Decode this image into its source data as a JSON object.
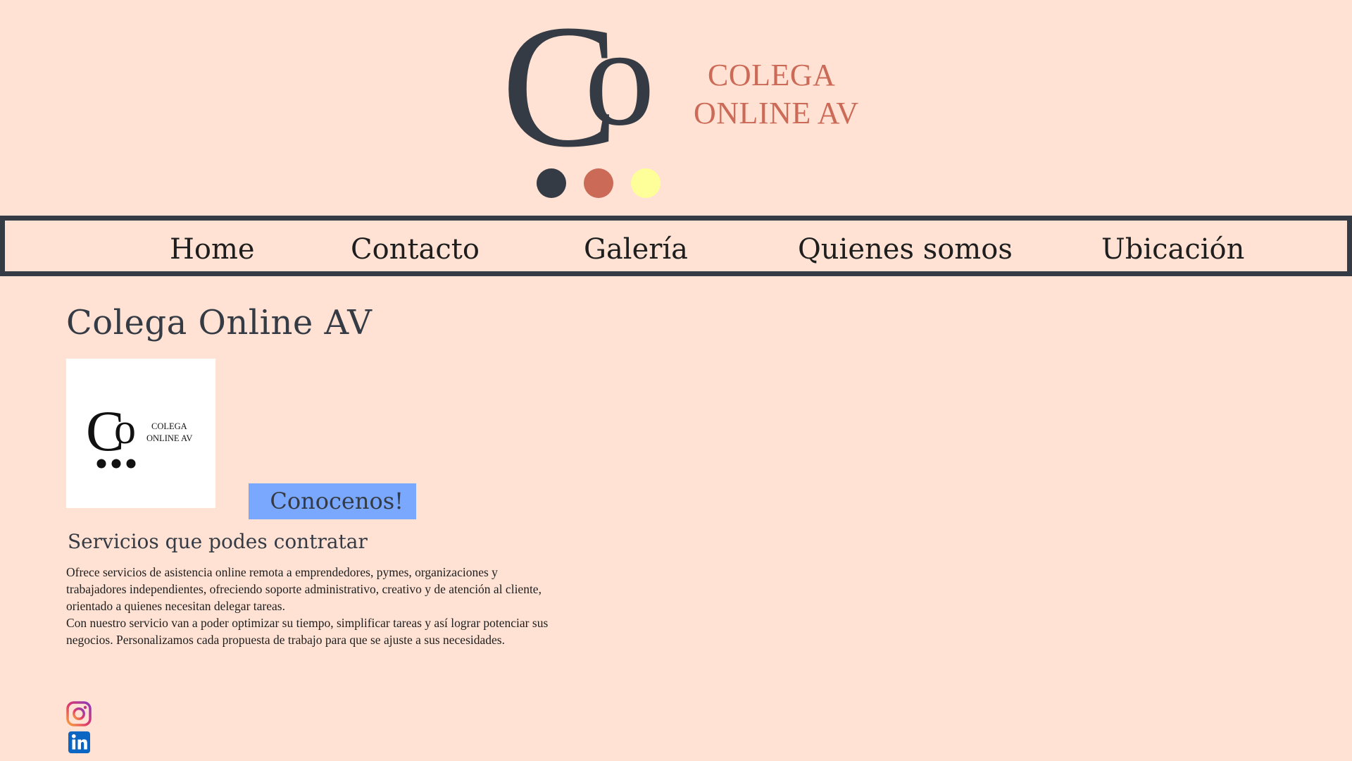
{
  "header": {
    "logo_line1": "COLEGA",
    "logo_line2": "ONLINE AV",
    "logo_colors": [
      "#353b45",
      "#cc6a58",
      "#ffff99"
    ]
  },
  "nav": {
    "items": [
      {
        "label": "Home"
      },
      {
        "label": "Contacto"
      },
      {
        "label": "Galería"
      },
      {
        "label": "Quienes somos"
      },
      {
        "label": "Ubicación"
      }
    ]
  },
  "main": {
    "title": "Colega Online AV",
    "thumb_line1": "COLEGA",
    "thumb_line2": "ONLINE AV",
    "cta_label": "Conocenos!",
    "section_title": "Servicios que podes contratar",
    "paragraph1": "Ofrece servicios de asistencia online remota a emprendedores, pymes, organizaciones y trabajadores independientes, ofreciendo soporte administrativo, creativo y de atención al cliente, orientado a quienes necesitan delegar tareas.",
    "paragraph2": "Con nuestro servicio van a poder optimizar su tiempo, simplificar tareas y así lograr potenciar sus negocios. Personalizamos cada propuesta de trabajo para que se ajuste a sus necesidades."
  },
  "social": {
    "items": [
      {
        "icon": "instagram-icon"
      },
      {
        "icon": "linkedin-icon"
      }
    ]
  },
  "colors": {
    "background": "#ffe2d3",
    "accent_dark": "#353b45",
    "accent_terracotta": "#cc6a58",
    "accent_yellow": "#ffff99",
    "button_blue": "#7aa8ff"
  }
}
